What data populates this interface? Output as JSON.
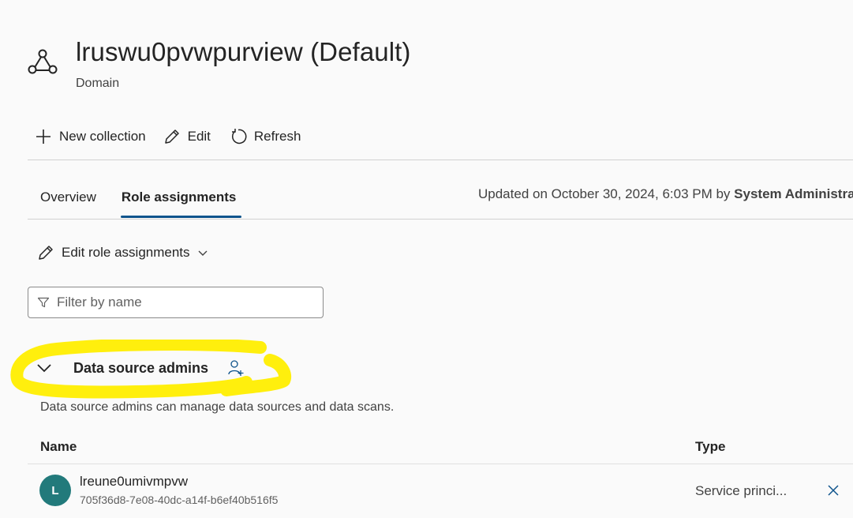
{
  "header": {
    "icon": "collection-icon",
    "title": "lruswu0pvwpurview (Default)",
    "subtitle": "Domain"
  },
  "toolbar": {
    "new_collection_label": "New collection",
    "edit_label": "Edit",
    "refresh_label": "Refresh"
  },
  "tabs": [
    {
      "label": "Overview",
      "active": false
    },
    {
      "label": "Role assignments",
      "active": true
    }
  ],
  "updated": {
    "prefix": "Updated on October 30, 2024, 6:03 PM by ",
    "user": "System Administra"
  },
  "edit_role_assignments": {
    "label": "Edit role assignments"
  },
  "filter": {
    "placeholder": "Filter by name",
    "value": ""
  },
  "section": {
    "title": "Data source admins",
    "description": "Data source admins can manage data sources and data scans.",
    "highlight_color": "#ffee00"
  },
  "table": {
    "columns": [
      "Name",
      "Type"
    ],
    "rows": [
      {
        "avatar_initial": "L",
        "avatar_color": "#227a7b",
        "name": "lreune0umivmpvw",
        "id": "705f36d8-7e08-40dc-a14f-b6ef40b516f5",
        "type": "Service princi..."
      }
    ]
  },
  "colors": {
    "accent": "#0f548c",
    "background": "#fafafa"
  }
}
